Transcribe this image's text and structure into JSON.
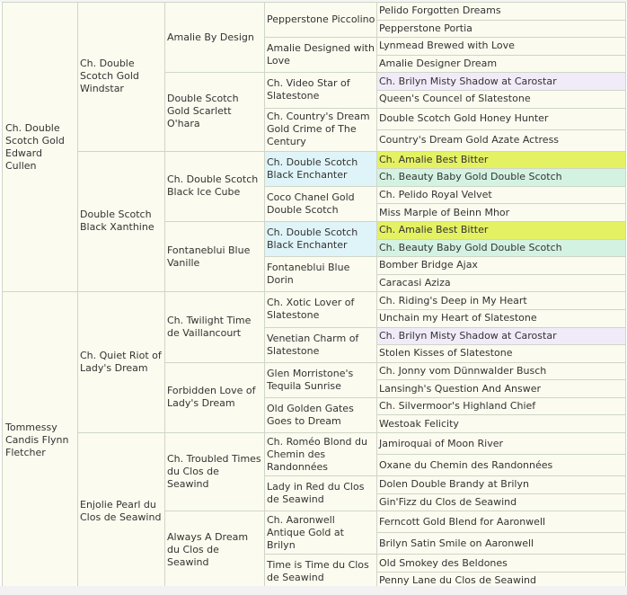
{
  "highlights": {
    "yellow": "#e4f163",
    "mint": "#d4f2e2",
    "lavender": "#f1ebf9",
    "cyan": "#dff4f8"
  },
  "pedigree": {
    "sire": {
      "name": "Ch. Double Scotch Gold Edward Cullen",
      "sire": {
        "name": "Ch. Double Scotch Gold Windstar",
        "sire": {
          "name": "Amalie By Design",
          "sire": {
            "name": "Pepperstone Piccolino",
            "sire": "Pelido Forgotten Dreams",
            "dam": "Pepperstone Portia"
          },
          "dam": {
            "name": "Amalie Designed with Love",
            "sire": "Lynmead Brewed with Love",
            "dam": "Amalie Designer Dream"
          }
        },
        "dam": {
          "name": "Double Scotch Gold Scarlett O'hara",
          "sire": {
            "name": "Ch. Video Star of Slatestone",
            "sire": "Ch. Brilyn Misty Shadow at Carostar",
            "dam": "Queen's Councel of Slatestone"
          },
          "dam": {
            "name": "Ch. Country's Dream Gold Crime of The Century",
            "sire": "Double Scotch Gold Honey Hunter",
            "dam": "Country's Dream Gold Azate Actress"
          }
        }
      },
      "dam": {
        "name": "Double Scotch Black Xanthine",
        "sire": {
          "name": "Ch. Double Scotch Black Ice Cube",
          "sire": {
            "name": "Ch. Double Scotch Black Enchanter",
            "sire": "Ch. Amalie Best Bitter",
            "dam": "Ch. Beauty Baby Gold Double Scotch"
          },
          "dam": {
            "name": "Coco Chanel Gold Double Scotch",
            "sire": "Ch. Pelido Royal Velvet",
            "dam": "Miss Marple of Beinn Mhor"
          }
        },
        "dam": {
          "name": "Fontaneblui Blue Vanille",
          "sire": {
            "name": "Ch. Double Scotch Black Enchanter",
            "sire": "Ch. Amalie Best Bitter",
            "dam": "Ch. Beauty Baby Gold Double Scotch"
          },
          "dam": {
            "name": "Fontaneblui Blue Dorin",
            "sire": "Bomber Bridge Ajax",
            "dam": "Caracasi Aziza"
          }
        }
      }
    },
    "dam": {
      "name": "Tommessy Candis Flynn Fletcher",
      "sire": {
        "name": "Ch. Quiet Riot of Lady's Dream",
        "sire": {
          "name": "Ch. Twilight Time de Vaillancourt",
          "sire": {
            "name": "Ch. Xotic Lover of Slatestone",
            "sire": "Ch. Riding's Deep in My Heart",
            "dam": "Unchain my Heart of Slatestone"
          },
          "dam": {
            "name": "Venetian Charm of Slatestone",
            "sire": "Ch. Brilyn Misty Shadow at Carostar",
            "dam": "Stolen Kisses of Slatestone"
          }
        },
        "dam": {
          "name": "Forbidden Love of Lady's Dream",
          "sire": {
            "name": "Glen Morristone's Tequila Sunrise",
            "sire": "Ch. Jonny vom Dünnwalder Busch",
            "dam": "Lansingh's Question And Answer"
          },
          "dam": {
            "name": "Old Golden Gates Goes to Dream",
            "sire": "Ch. Silvermoor's Highland Chief",
            "dam": "Westoak Felicity"
          }
        }
      },
      "dam": {
        "name": "Enjolie Pearl du Clos de Seawind",
        "sire": {
          "name": "Ch. Troubled Times du Clos de Seawind",
          "sire": {
            "name": "Ch. Roméo Blond du Chemin des Randonnées",
            "sire": "Jamiroquai of Moon River",
            "dam": "Oxane du Chemin des Randonnées"
          },
          "dam": {
            "name": "Lady in Red du Clos de Seawind",
            "sire": "Dolen Double Brandy at Brilyn",
            "dam": "Gin'Fizz du Clos de Seawind"
          }
        },
        "dam": {
          "name": "Always A Dream du Clos de Seawind",
          "sire": {
            "name": "Ch. Aaronwell Antique Gold at Brilyn",
            "sire": "Ferncott Gold Blend for Aaronwell",
            "dam": "Brilyn Satin Smile on Aaronwell"
          },
          "dam": {
            "name": "Time is Time du Clos de Seawind",
            "sire": "Old Smokey des Beldones",
            "dam": "Penny Lane du Clos de Seawind"
          }
        }
      }
    }
  }
}
